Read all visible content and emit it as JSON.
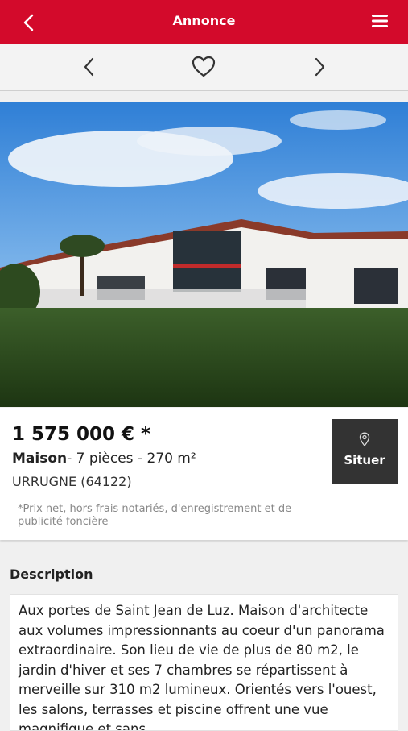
{
  "header": {
    "title": "Annonce",
    "bg_color": "#d30a2b"
  },
  "nav": {
    "prev_icon": "chevron-left-icon",
    "favorite_icon": "heart-icon",
    "next_icon": "chevron-right-icon"
  },
  "listing": {
    "price": "1 575 000 € *",
    "type": "Maison",
    "details": "- 7 pièces - 270 m²",
    "city": "URRUGNE (64122)",
    "price_note": "*Prix net, hors frais notariés, d'enregistrement et de publicité foncière",
    "locate_label": "Situer"
  },
  "description": {
    "title": "Description",
    "text": "Aux portes de Saint Jean de Luz. Maison d'architecte aux volumes impressionnants au coeur d'un panorama extraordinaire. Son lieu de vie de plus de 80 m2, le jardin d'hiver et ses 7 chambres se répartissent à merveille sur 310 m2 lumineux. Orientés vers l'ouest, les salons, terrasses et piscine offrent une vue magnifique et sans"
  }
}
